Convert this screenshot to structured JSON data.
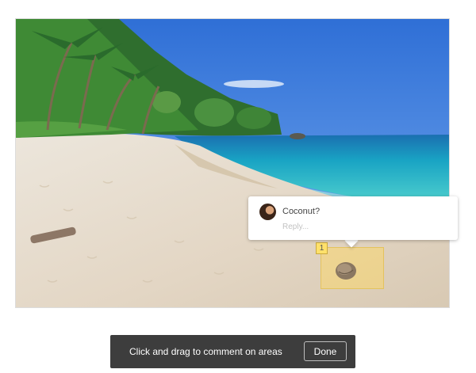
{
  "annotation": {
    "number": "1",
    "comment": {
      "text": "Coconut?",
      "reply_placeholder": "Reply..."
    }
  },
  "toolbar": {
    "instruction": "Click and drag to comment on areas",
    "done_label": "Done"
  }
}
